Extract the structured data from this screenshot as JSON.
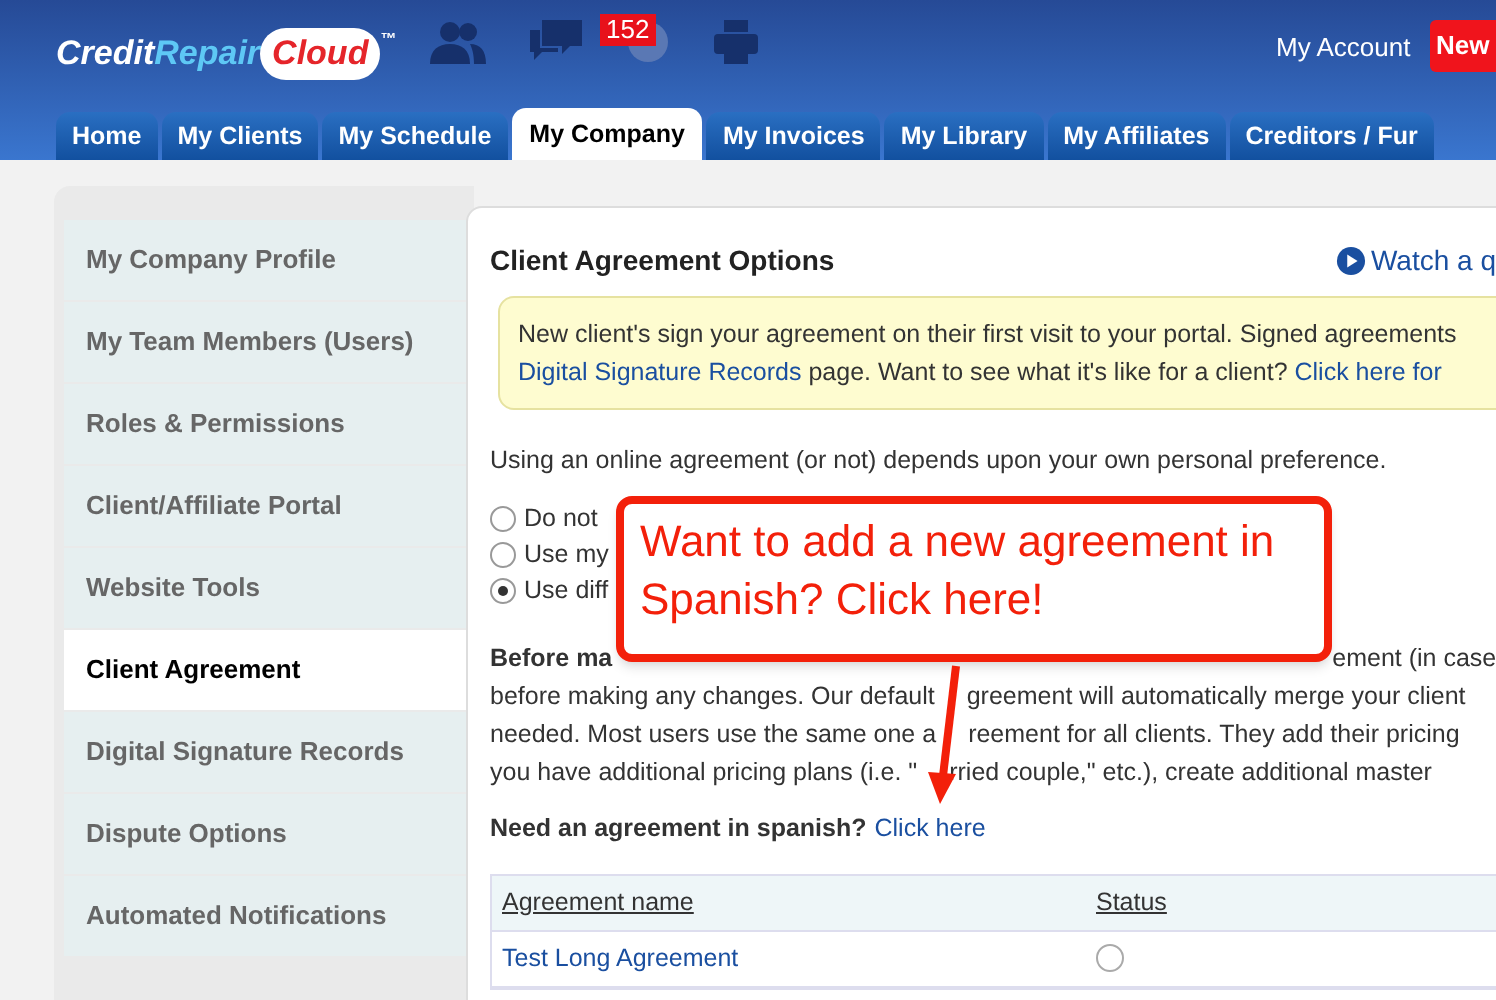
{
  "header": {
    "logo": {
      "parts": [
        "Credit",
        "Repair",
        "Cloud"
      ],
      "mark": "™"
    },
    "notification_count": "152",
    "account_link": "My Account",
    "new_button": "New"
  },
  "tabs": [
    {
      "label": "Home",
      "selected": false
    },
    {
      "label": "My Clients",
      "selected": false
    },
    {
      "label": "My Schedule",
      "selected": false
    },
    {
      "label": "My Company",
      "selected": true
    },
    {
      "label": "My Invoices",
      "selected": false
    },
    {
      "label": "My Library",
      "selected": false
    },
    {
      "label": "My Affiliates",
      "selected": false
    },
    {
      "label": "Creditors / Fur",
      "selected": false
    }
  ],
  "sidebar": {
    "items": [
      {
        "label": "My Company Profile",
        "selected": false
      },
      {
        "label": "My Team Members (Users)",
        "selected": false
      },
      {
        "label": "Roles & Permissions",
        "selected": false
      },
      {
        "label": "Client/Affiliate Portal",
        "selected": false
      },
      {
        "label": "Website Tools",
        "selected": false
      },
      {
        "label": "Client Agreement",
        "selected": true
      },
      {
        "label": "Digital Signature Records",
        "selected": false
      },
      {
        "label": "Dispute Options",
        "selected": false
      },
      {
        "label": "Automated Notifications",
        "selected": false
      }
    ]
  },
  "content": {
    "title": "Client Agreement Options",
    "video_link": "Watch a q",
    "notice": {
      "lines": [
        [
          {
            "kind": "text",
            "text": "New client's sign your agreement on their first visit to your portal. Signed agreements"
          }
        ],
        [
          {
            "kind": "link",
            "text": "Digital Signature Records"
          },
          {
            "kind": "text",
            "text": " page. Want to see what it's like for a client? "
          },
          {
            "kind": "link",
            "text": "Click here for"
          }
        ]
      ]
    },
    "intro": "Using an online agreement (or not) depends upon your own personal preference.",
    "options": [
      {
        "label": "Do not",
        "selected": false
      },
      {
        "label": "Use my",
        "selected": false
      },
      {
        "label": "Use diff",
        "selected": true
      }
    ],
    "details": {
      "lead": "Before ma",
      "tail": "ement (in case",
      "lines": [
        {
          "before": "before making any changes. Our default",
          "after": "greement will automatically merge your client"
        },
        {
          "before": "needed. Most users use the same one a",
          "after": "reement for all clients. They add their pricing"
        },
        {
          "before": "you have additional pricing plans (i.e. \"",
          "after": "rried couple,\" etc.), create additional master"
        }
      ]
    },
    "spanish_prompt": "Need an agreement in spanish?",
    "spanish_link": "Click here",
    "table": {
      "columns": [
        "Agreement name",
        "Status"
      ],
      "rows": [
        {
          "name": "Test Long Agreement",
          "selected": false
        }
      ]
    },
    "callout": "Want to add a new agreement in Spanish? Click here!"
  }
}
